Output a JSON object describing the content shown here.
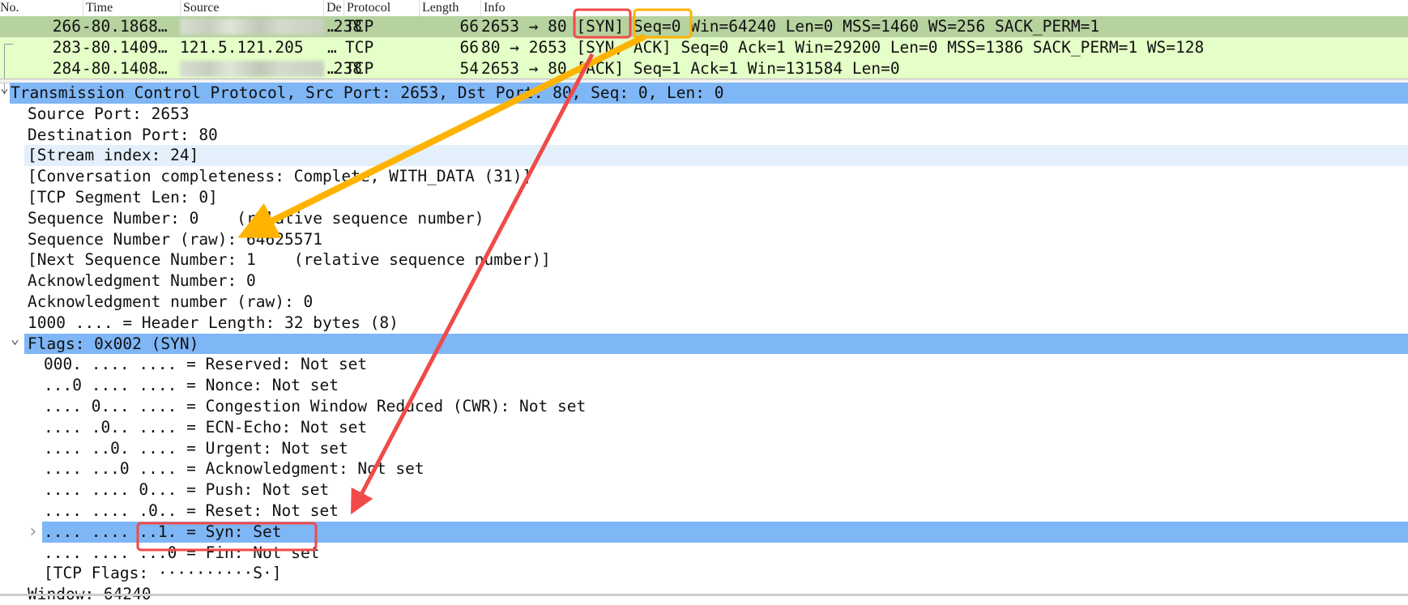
{
  "packet_list": {
    "columns": [
      "No.",
      "Time",
      "Source",
      "De",
      "Protocol",
      "Length",
      "Info"
    ],
    "rows": [
      {
        "no": "266",
        "time": "-80.1868…",
        "source": ".238",
        "source_blurred": true,
        "dest": "…",
        "protocol": "TCP",
        "length": "66",
        "info": "2653 → 80 [SYN] Seq=0 Win=64240 Len=0 MSS=1460 WS=256 SACK_PERM=1",
        "selected": true
      },
      {
        "no": "283",
        "time": "-80.1409…",
        "source": "121.5.121.205",
        "source_blurred": false,
        "dest": "…",
        "protocol": "TCP",
        "length": "66",
        "info": "80 → 2653 [SYN, ACK] Seq=0 Ack=1 Win=29200 Len=0 MSS=1386 SACK_PERM=1 WS=128",
        "selected": false
      },
      {
        "no": "284",
        "time": "-80.1408…",
        "source": ".238",
        "source_blurred": true,
        "dest": "…",
        "protocol": "TCP",
        "length": "54",
        "info": "2653 → 80 [ACK] Seq=1 Ack=1 Win=131584 Len=0",
        "selected": false
      }
    ]
  },
  "details": {
    "lines": [
      "Transmission Control Protocol, Src Port: 2653, Dst Port: 80, Seq: 0, Len: 0",
      "Source Port: 2653",
      "Destination Port: 80",
      "[Stream index: 24]",
      "[Conversation completeness: Complete, WITH_DATA (31)]",
      "[TCP Segment Len: 0]",
      "Sequence Number: 0    (relative sequence number)",
      "Sequence Number (raw): 64625571",
      "[Next Sequence Number: 1    (relative sequence number)]",
      "Acknowledgment Number: 0",
      "Acknowledgment number (raw): 0",
      "1000 .... = Header Length: 32 bytes (8)",
      "Flags: 0x002 (SYN)",
      "000. .... .... = Reserved: Not set",
      "...0 .... .... = Nonce: Not set",
      ".... 0... .... = Congestion Window Reduced (CWR): Not set",
      ".... .0.. .... = ECN-Echo: Not set",
      ".... ..0. .... = Urgent: Not set",
      ".... ...0 .... = Acknowledgment: Not set",
      ".... .... 0... = Push: Not set",
      ".... .... .0.. = Reset: Not set",
      ".... .... ..1. = Syn: Set",
      ".... .... ...0 = Fin: Not set",
      "[TCP Flags: ··········S·]",
      "Window: 64240"
    ]
  },
  "colors": {
    "selected_row": "#b5d29f",
    "tcp_row": "#e4ffc7",
    "highlight": "#7fb6f5",
    "annotation_red": "#f04a4a",
    "annotation_orange": "#ffb300"
  }
}
